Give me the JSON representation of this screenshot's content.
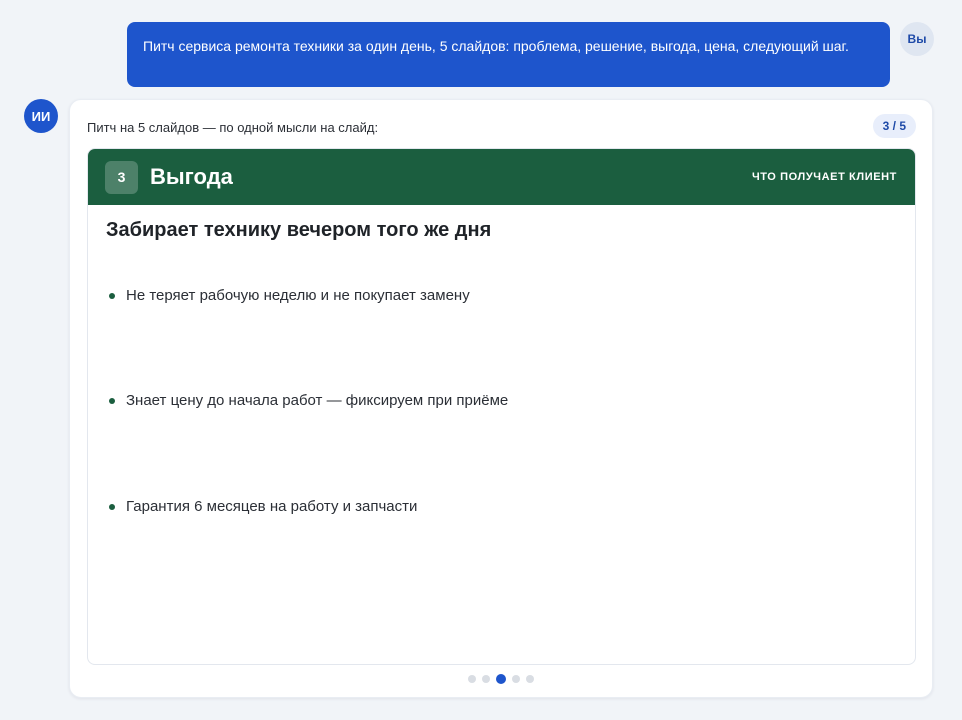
{
  "user": {
    "avatar": "Вы",
    "message": "Питч сервиса ремонта техники за один день, 5 слайдов: проблема, решение, выгода, цена, следующий шаг."
  },
  "assistant": {
    "avatar": "ИИ",
    "intro": "Питч на 5 слайдов — по одной мысли на слайд:",
    "counter": "3 / 5"
  },
  "slide": {
    "number": "3",
    "title": "Выгода",
    "tag": "ЧТО ПОЛУЧАЕТ КЛИЕНТ",
    "headline": "Забирает технику вечером того же дня",
    "bullets": [
      "Не теряет рабочую неделю и не покупает замену",
      "Знает цену до начала работ — фиксируем при приёме",
      "Гарантия 6 месяцев на работу и запчасти"
    ],
    "accent_color": "#1b5e3f"
  },
  "pagination": {
    "total": 5,
    "active": 3
  }
}
